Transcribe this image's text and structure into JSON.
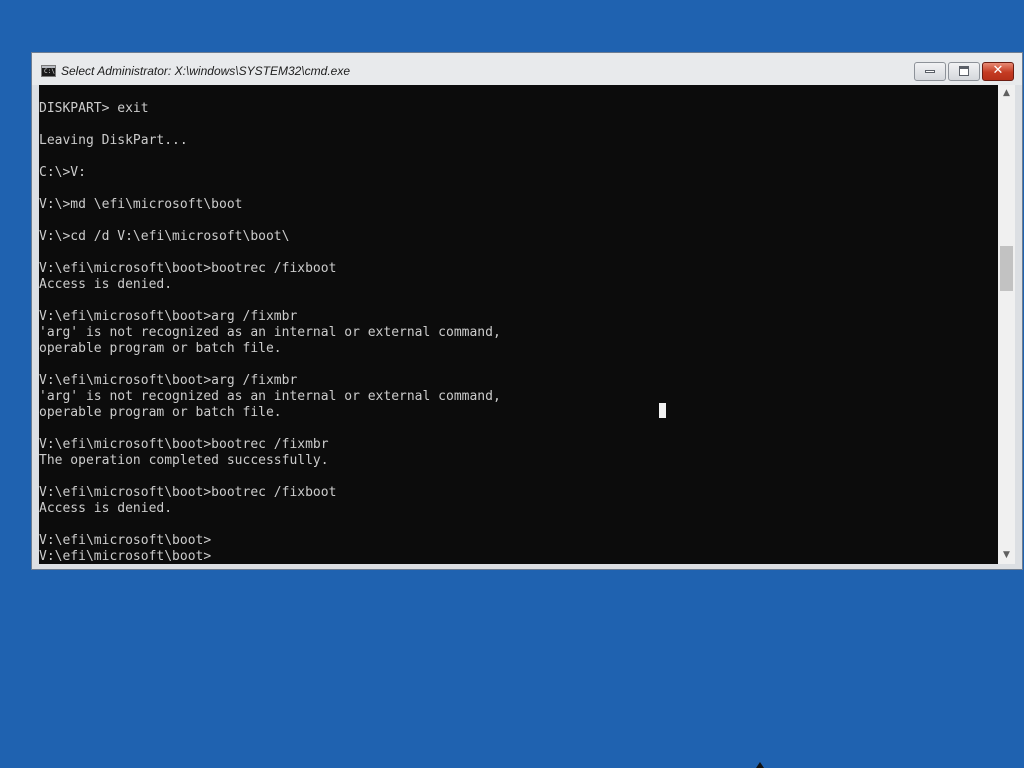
{
  "window": {
    "title": "Select Administrator: X:\\windows\\SYSTEM32\\cmd.exe",
    "icon_name": "cmd-icon",
    "icon_text": "C:\\",
    "controls": {
      "minimize": "minimize-icon",
      "maximize": "maximize-icon",
      "close_label": "✕"
    }
  },
  "console": {
    "lines": [
      "DISKPART> exit",
      "",
      "Leaving DiskPart...",
      "",
      "C:\\>V:",
      "",
      "V:\\>md \\efi\\microsoft\\boot",
      "",
      "V:\\>cd /d V:\\efi\\microsoft\\boot\\",
      "",
      "V:\\efi\\microsoft\\boot>bootrec /fixboot",
      "Access is denied.",
      "",
      "V:\\efi\\microsoft\\boot>arg /fixmbr",
      "'arg' is not recognized as an internal or external command,",
      "operable program or batch file.",
      "",
      "V:\\efi\\microsoft\\boot>arg /fixmbr",
      "'arg' is not recognized as an internal or external command,",
      "operable program or batch file.",
      "",
      "V:\\efi\\microsoft\\boot>bootrec /fixmbr",
      "The operation completed successfully.",
      "",
      "V:\\efi\\microsoft\\boot>bootrec /fixboot",
      "Access is denied.",
      "",
      "V:\\efi\\microsoft\\boot>",
      "V:\\efi\\microsoft\\boot>"
    ],
    "colors": {
      "background": "#0c0c0c",
      "text": "#cccccc"
    }
  },
  "scrollbar": {
    "up_arrow": "▲",
    "down_arrow": "▼",
    "position": 0.36,
    "visible_fraction": 0.1
  },
  "desktop": {
    "background": "#1f62b0"
  }
}
